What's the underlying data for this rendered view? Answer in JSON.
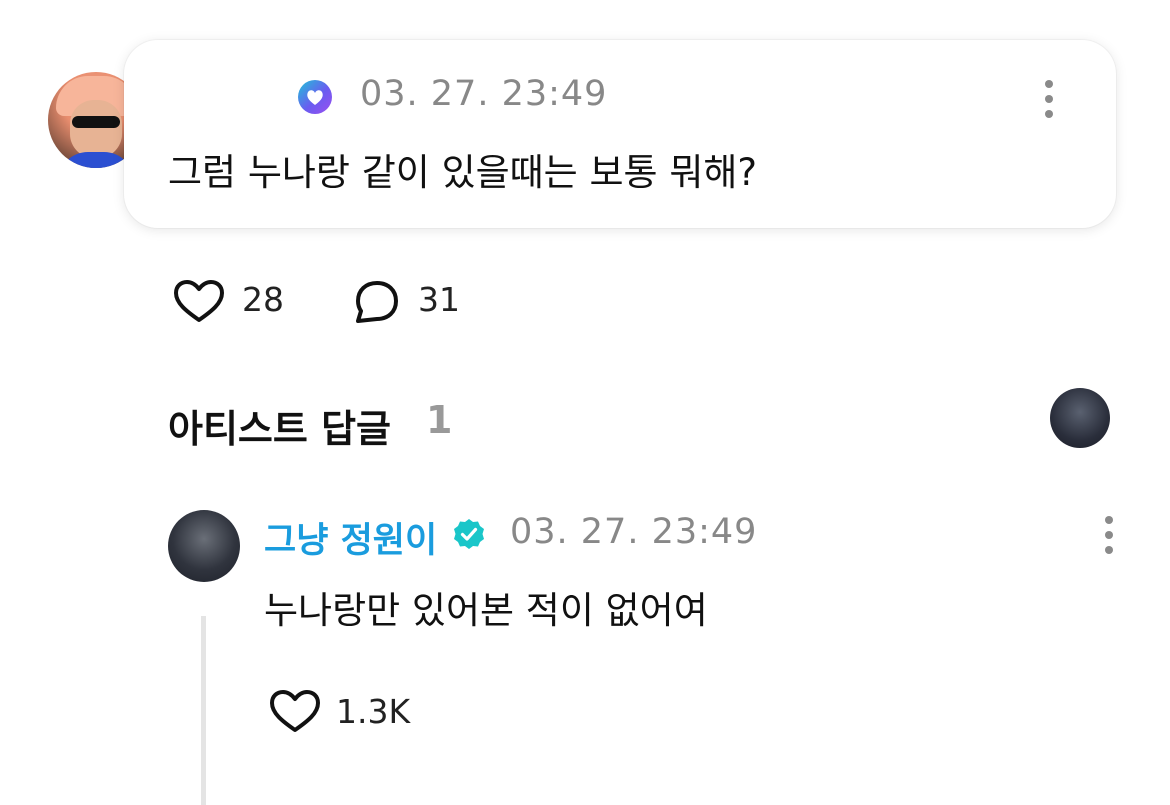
{
  "fan_comment": {
    "avatar": "fan-avatar",
    "badge_icon": "weverse-membership-icon",
    "timestamp": "03. 27. 23:49",
    "text": "그럼 누나랑 같이 있을때는 보통 뭐해?",
    "likes": "28",
    "replies": "31"
  },
  "artist_section": {
    "title": "아티스트 답글",
    "count": "1"
  },
  "artist_reply": {
    "name": "그냥 정원이",
    "verified_color": "#1ac6c9",
    "timestamp": "03. 27. 23:49",
    "text": "누나랑만 있어본 적이 없어여",
    "likes": "1.3K"
  },
  "colors": {
    "artist_name": "#1a9cde",
    "muted": "#888888"
  }
}
